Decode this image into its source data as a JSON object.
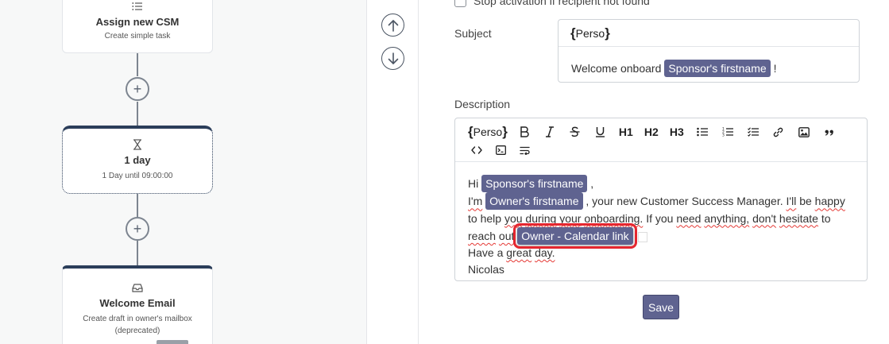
{
  "canvas": {
    "nodes": [
      {
        "title": "Assign new CSM",
        "subtitle": "Create simple task",
        "icon": "list-icon"
      },
      {
        "title": "1 day",
        "subtitle": "1 Day until 09:00:00",
        "icon": "hourglass-icon"
      },
      {
        "title": "Welcome Email",
        "subtitle": "Create draft in owner's mailbox (deprecated)",
        "icon": "inbox-icon"
      }
    ],
    "add_step_label": "+"
  },
  "form": {
    "stop_activation_label": "Stop activation if recipient not found",
    "subject": {
      "label": "Subject",
      "perso_label": "Perso",
      "text_prefix": "Welcome onboard",
      "tag": "Sponsor's firstname",
      "text_suffix": "!"
    },
    "description": {
      "label": "Description",
      "toolbar": {
        "perso": "Perso",
        "h1": "H1",
        "h2": "H2",
        "h3": "H3"
      },
      "body": {
        "hi": "Hi",
        "sponsor_tag": "Sponsor's firstname",
        "comma": ",",
        "im": "I'm",
        "owner_tag": "Owner's firstname",
        "line2_rest_1": ", your new Customer Success Manager.",
        "ill": "I'll",
        "line2_rest_2": "be",
        "happy": "happy",
        "line3_to": "to help",
        "you": "you",
        "during": "during",
        "your": "your",
        "onboarding": "onboarding.",
        "if_you": "If you",
        "need": "need",
        "anything": "anything,",
        "dont": "don't",
        "hesitate": "hesitate",
        "to": "to",
        "reach": "reach",
        "out": "out",
        "calendar_tag": "Owner - Calendar link",
        "have_a": "Have a",
        "great": "great",
        "day": "day.",
        "signature": "Nicolas"
      }
    },
    "save_label": "Save"
  },
  "colors": {
    "tag_bg": "#5f6390",
    "node_top": "#2b3e5a",
    "highlight": "#e5262f"
  }
}
